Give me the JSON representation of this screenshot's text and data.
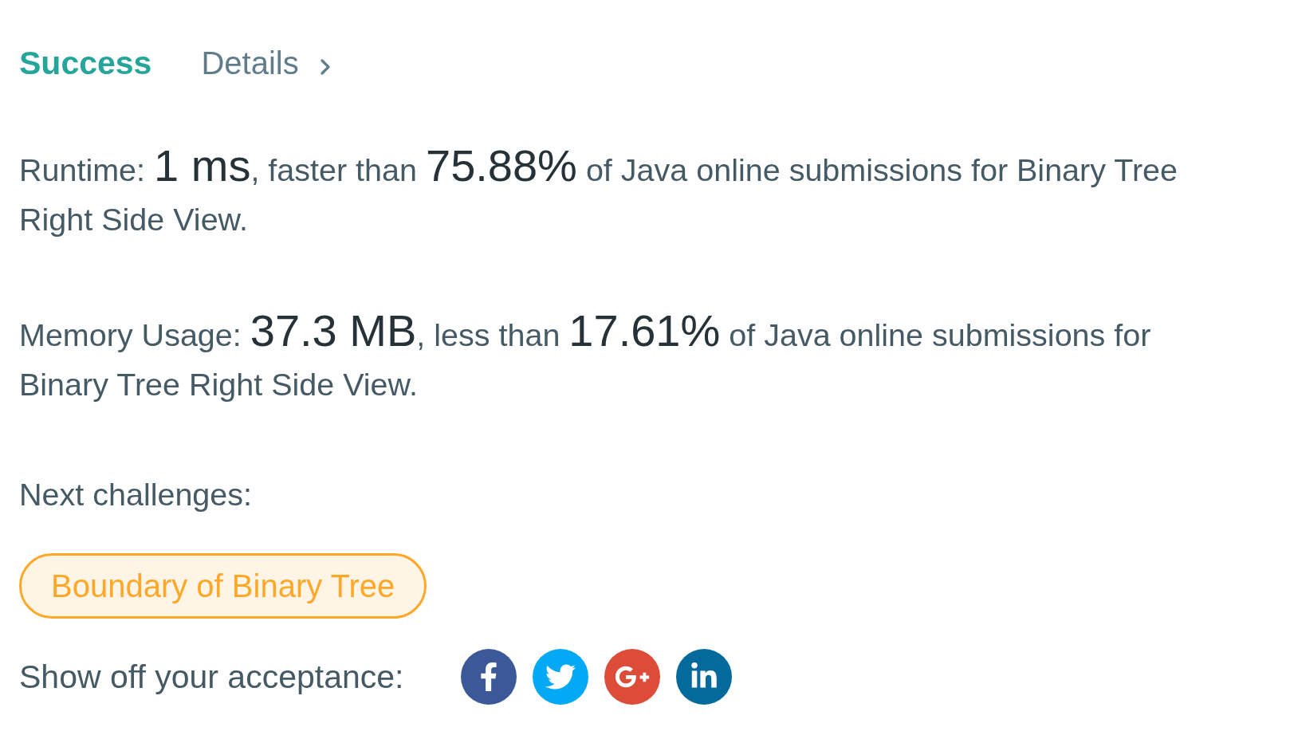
{
  "result": {
    "status": {
      "label": "Success",
      "kind": "success"
    },
    "details_link": {
      "label": "Details"
    }
  },
  "stats": [
    {
      "label": "Runtime:",
      "value": "1 ms",
      "comparison": ", faster than",
      "percent": "75.88%",
      "rest": "of Java online submissions for Binary Tree Right Side View."
    },
    {
      "label": "Memory Usage:",
      "value": "37.3 MB",
      "comparison": ", less than",
      "percent": "17.61%",
      "rest": "of Java online submissions for Binary Tree Right Side View."
    }
  ],
  "next_challenges": {
    "heading": "Next challenges:",
    "items": [
      {
        "title": "Boundary of Binary Tree",
        "color": "#ffa726"
      }
    ]
  },
  "share": {
    "label": "Show off your acceptance:",
    "buttons": [
      {
        "kind": "facebook"
      },
      {
        "kind": "twitter"
      },
      {
        "kind": "google-plus"
      },
      {
        "kind": "linkedin"
      }
    ]
  }
}
